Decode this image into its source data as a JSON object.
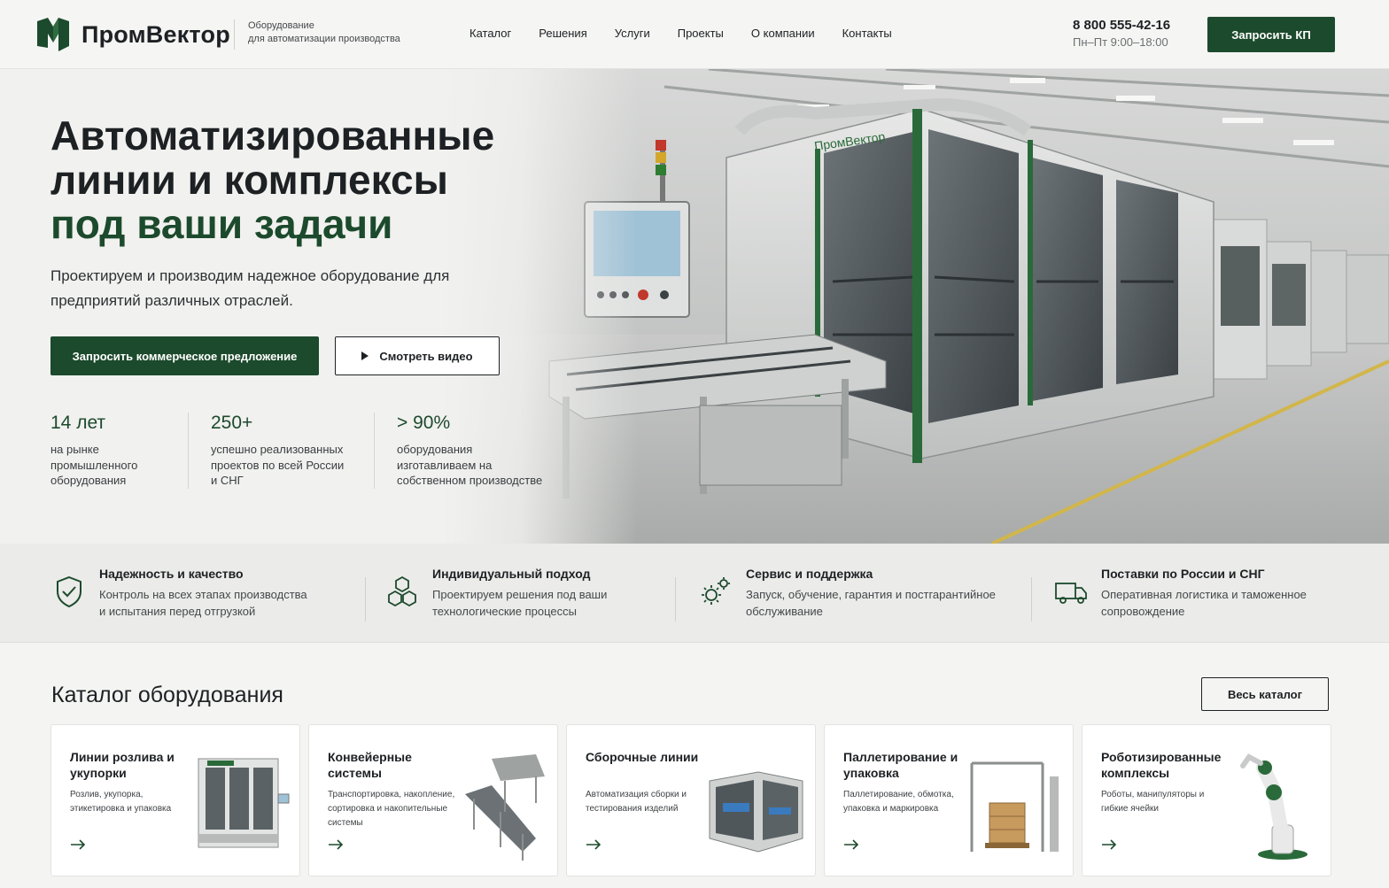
{
  "brand": {
    "name": "ПромВектор",
    "tagline_line1": "Оборудование",
    "tagline_line2": "для автоматизации производства",
    "accent": "#1c4a2c"
  },
  "nav": {
    "items": [
      "Каталог",
      "Решения",
      "Услуги",
      "Проекты",
      "О компании",
      "Контакты"
    ]
  },
  "contact": {
    "phone": "8 800 555-42-16",
    "hours": "Пн–Пт  9:00–18:00"
  },
  "header": {
    "cta_label": "Запросить КП"
  },
  "hero": {
    "title_line1": "Автоматизированные",
    "title_line2": "линии и комплексы",
    "title_line3": "под ваши задачи",
    "subtitle": "Проектируем и производим надежное оборудование для предприятий различных отраслей.",
    "primary_label": "Запросить коммерческое предложение",
    "secondary_label": "Смотреть видео",
    "machine_brand": "ПромВектор",
    "stats": [
      {
        "value": "14 лет",
        "label": "на рынке промышленного оборудования"
      },
      {
        "value": "250+",
        "label": "успешно реализованных проектов по всей России и СНГ"
      },
      {
        "value": "> 90%",
        "label": "оборудования изготавливаем на собственном производстве"
      }
    ]
  },
  "features": [
    {
      "icon": "shield-check-icon",
      "title": "Надежность и качество",
      "desc": "Контроль на всех этапах производства и испытания перед отгрузкой"
    },
    {
      "icon": "cubes-icon",
      "title": "Индивидуальный подход",
      "desc": "Проектируем решения под ваши технологические процессы"
    },
    {
      "icon": "gears-icon",
      "title": "Сервис и поддержка",
      "desc": "Запуск, обучение, гарантия и постгарантийное обслуживание"
    },
    {
      "icon": "truck-icon",
      "title": "Поставки по России и СНГ",
      "desc": "Оперативная логистика и таможенное сопровождение"
    }
  ],
  "catalog": {
    "title": "Каталог оборудования",
    "all_label": "Весь каталог",
    "cards": [
      {
        "title": "Линии розлива и укупорки",
        "desc": "Розлив, укупорка, этикетировка и упаковка",
        "image": "filling-line-image"
      },
      {
        "title": "Конвейерные системы",
        "desc": "Транспортировка, накопление, сортировка и накопительные системы",
        "image": "conveyor-image"
      },
      {
        "title": "Сборочные линии",
        "desc": "Автоматизация сборки и тестирования изделий",
        "image": "assembly-cell-image"
      },
      {
        "title": "Паллетирование и упаковка",
        "desc": "Паллетирование, обмотка, упаковка и маркировка",
        "image": "palletizer-image"
      },
      {
        "title": "Роботизированные комплексы",
        "desc": "Роботы, манипуляторы и гибкие ячейки",
        "image": "robot-arm-image"
      }
    ]
  }
}
